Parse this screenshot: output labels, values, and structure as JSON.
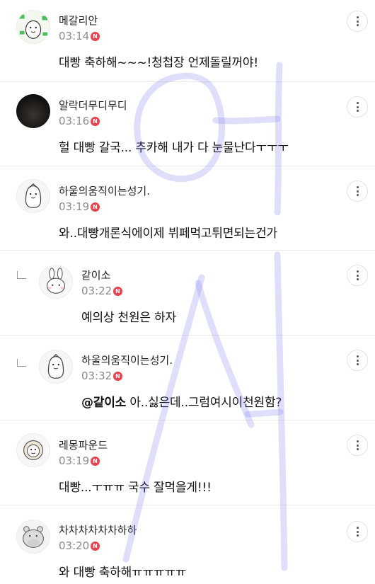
{
  "comments": [
    {
      "name": "메갈리안",
      "time": "03:14",
      "badge": "N",
      "text": "대빵 축하해~~~!청첩장 언제돌릴꺼야!"
    },
    {
      "name": "알락더무디무디",
      "time": "03:16",
      "badge": "N",
      "text": "헐 대빵 갈국... 추카해 내가 다 눈물난다ㅜㅜㅜ"
    },
    {
      "name": "하울의움직이는성기.",
      "time": "03:19",
      "badge": "N",
      "text": "와..대빵개론식에이제 뷔페먹고튀면되는건가"
    },
    {
      "name": "같이소",
      "time": "03:22",
      "badge": "N",
      "text": "예의상 천원은 하자"
    },
    {
      "name": "하울의움직이는성기.",
      "time": "03:32",
      "badge": "N",
      "mention": "@같이소",
      "text": " 아..싫은데..그럼여시이천원함?"
    },
    {
      "name": "레몽파운드",
      "time": "03:19",
      "badge": "N",
      "text": "대빵...ㅜㅠㅠ 국수 잘먹을게!!!"
    },
    {
      "name": "차차차차차차하하",
      "time": "03:20",
      "badge": "N",
      "text": "와 대빵 축하해ㅠㅠㅠㅠㅠ"
    }
  ],
  "colors": {
    "badge": "#e8424a",
    "watermark": "#6f6ff0"
  }
}
